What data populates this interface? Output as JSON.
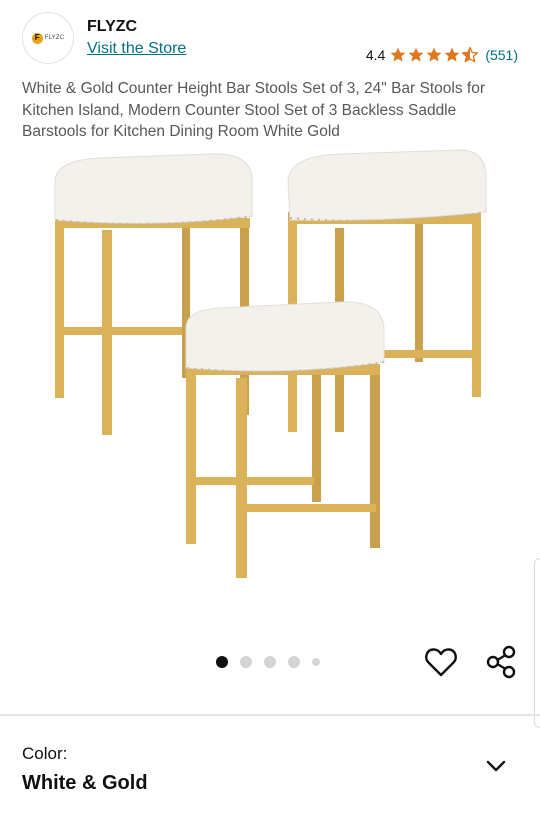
{
  "brand": {
    "logo_text": "FLYZC",
    "logo_letter": "F",
    "name": "FLYZC",
    "visit_store": "Visit the Store"
  },
  "rating": {
    "value": "4.4",
    "stars": 4.4,
    "count": "(551)",
    "star_color": "#de7921"
  },
  "product": {
    "title": "White & Gold Counter Height Bar Stools Set of 3, 24\" Bar Stools for Kitchen Island, Modern Counter Stool Set of 3 Backless Saddle Barstools for Kitchen Dining Room White Gold",
    "image_alt": "three white cushioned saddle bar stools with gold metal frames"
  },
  "gallery": {
    "total_images": 5,
    "active_index": 0
  },
  "actions": {
    "wishlist_icon": "heart-icon",
    "share_icon": "share-icon"
  },
  "variation": {
    "label": "Color:",
    "value": "White & Gold",
    "expand_icon": "chevron-down-icon"
  },
  "colors": {
    "link": "#007185",
    "text": "#0f1111",
    "subtext": "#565959",
    "stool_frame": "#d9b25a",
    "stool_cushion": "#f3f1ec"
  }
}
